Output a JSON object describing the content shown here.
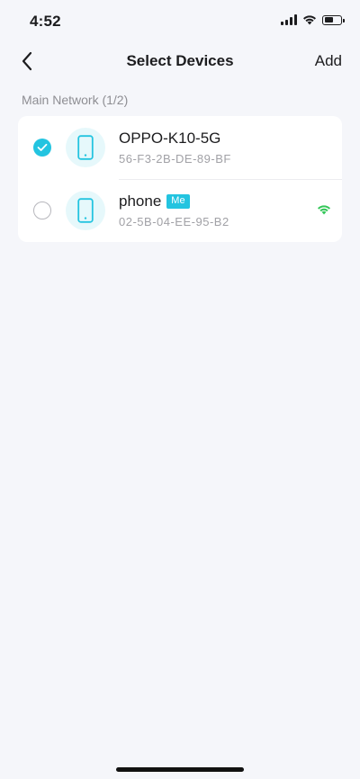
{
  "status_bar": {
    "time": "4:52",
    "battery_level": 0.6
  },
  "nav": {
    "title": "Select Devices",
    "add_label": "Add"
  },
  "section": {
    "label": "Main Network (1/2)"
  },
  "devices": [
    {
      "name": "OPPO-K10-5G",
      "mac": "56-F3-2B-DE-89-BF",
      "selected": true,
      "icon": "phone-icon"
    },
    {
      "name": "phone",
      "badge": "Me",
      "mac": "02-5B-04-EE-95-B2",
      "selected": false,
      "icon": "phone-icon",
      "connection_icon": "wifi-signal-icon"
    }
  ],
  "colors": {
    "accent": "#23c4e0",
    "wifi_green": "#34c759",
    "background": "#f5f6fa"
  }
}
